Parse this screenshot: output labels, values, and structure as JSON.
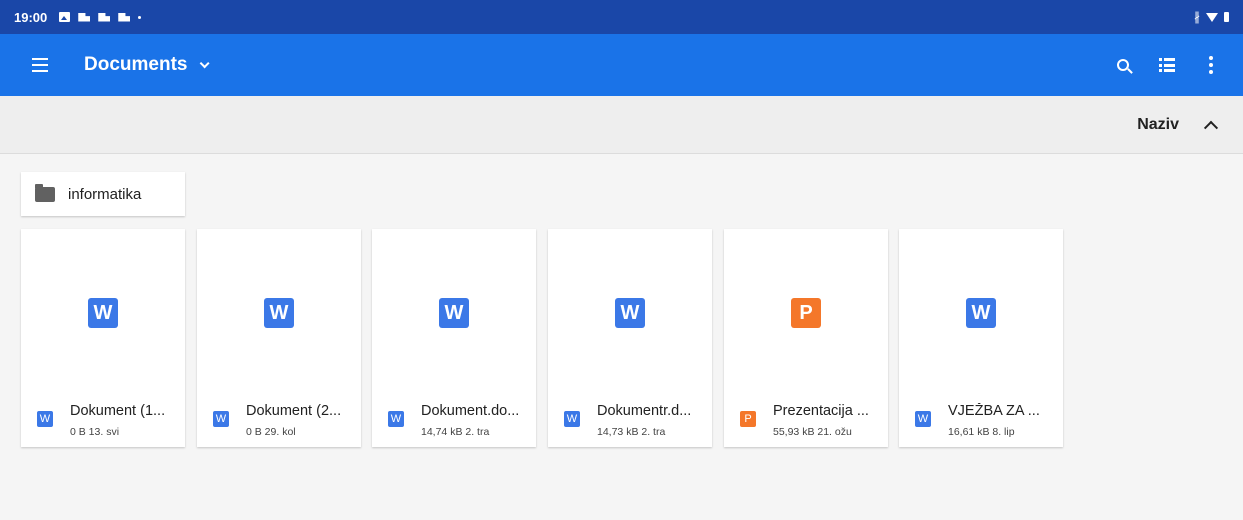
{
  "status_bar": {
    "time": "19:00"
  },
  "app_bar": {
    "title": "Documents"
  },
  "sort": {
    "label": "Naziv"
  },
  "folders": [
    {
      "name": "informatika"
    }
  ],
  "colors": {
    "word": "#3b78e7",
    "powerpoint": "#f4772a",
    "app_bar": "#1a73e8",
    "status_bar": "#1a47a8"
  },
  "files": [
    {
      "letter": "W",
      "type": "word",
      "name": "Dokument (1...",
      "info": "0 B 13. svi"
    },
    {
      "letter": "W",
      "type": "word",
      "name": "Dokument (2...",
      "info": "0 B 29. kol"
    },
    {
      "letter": "W",
      "type": "word",
      "name": "Dokument.do...",
      "info": "14,74 kB 2. tra"
    },
    {
      "letter": "W",
      "type": "word",
      "name": "Dokumentr.d...",
      "info": "14,73 kB 2. tra"
    },
    {
      "letter": "P",
      "type": "powerpoint",
      "name": "Prezentacija ...",
      "info": "55,93 kB 21. ožu"
    },
    {
      "letter": "W",
      "type": "word",
      "name": "VJEŽBA ZA ...",
      "info": "16,61 kB 8. lip"
    }
  ]
}
